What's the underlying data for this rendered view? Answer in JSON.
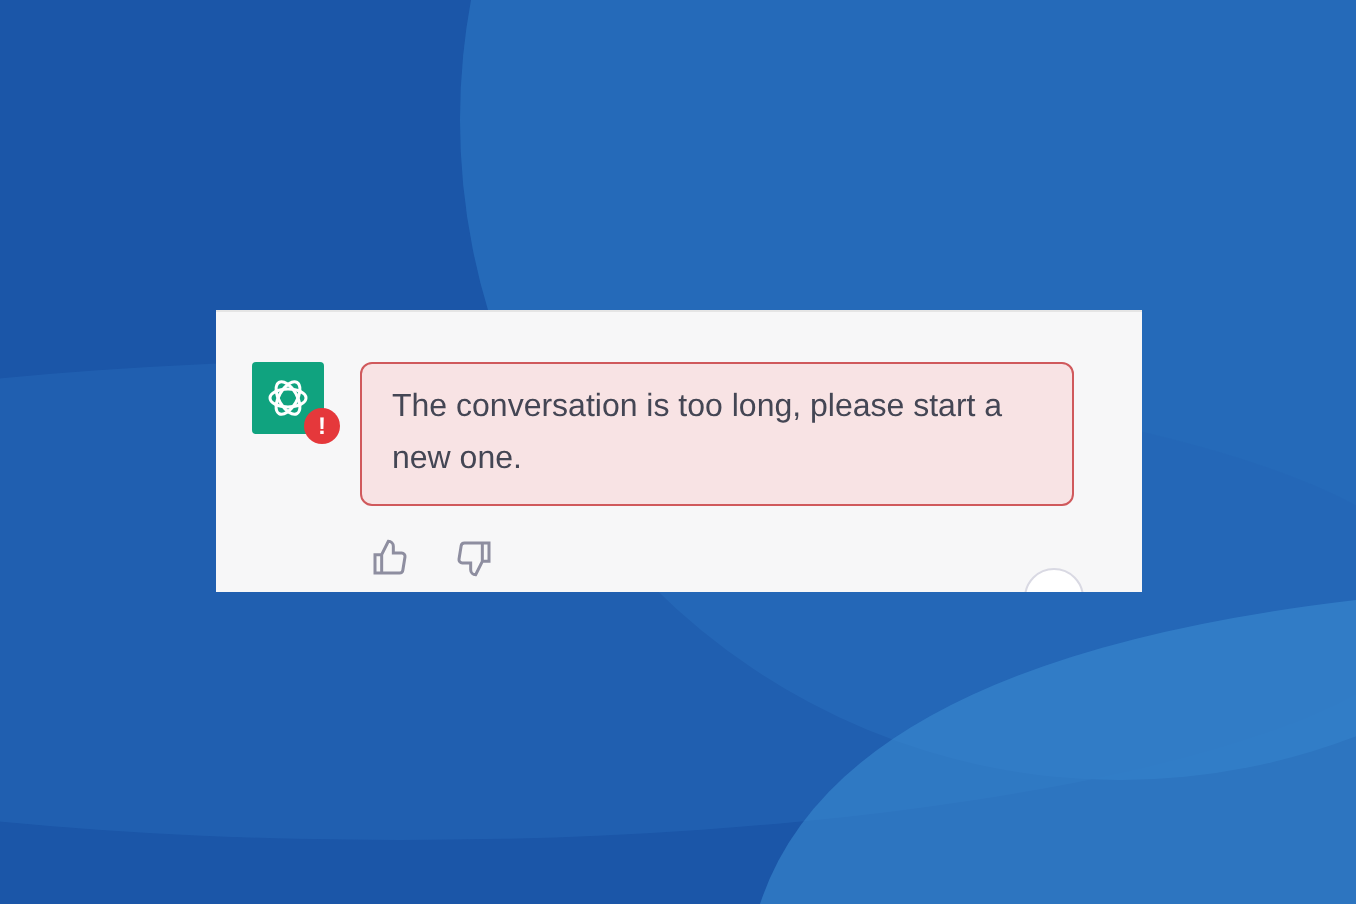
{
  "message": {
    "kind": "error",
    "text": "The conversation is too long, please start a new one."
  },
  "avatar": {
    "badge": "!"
  }
}
